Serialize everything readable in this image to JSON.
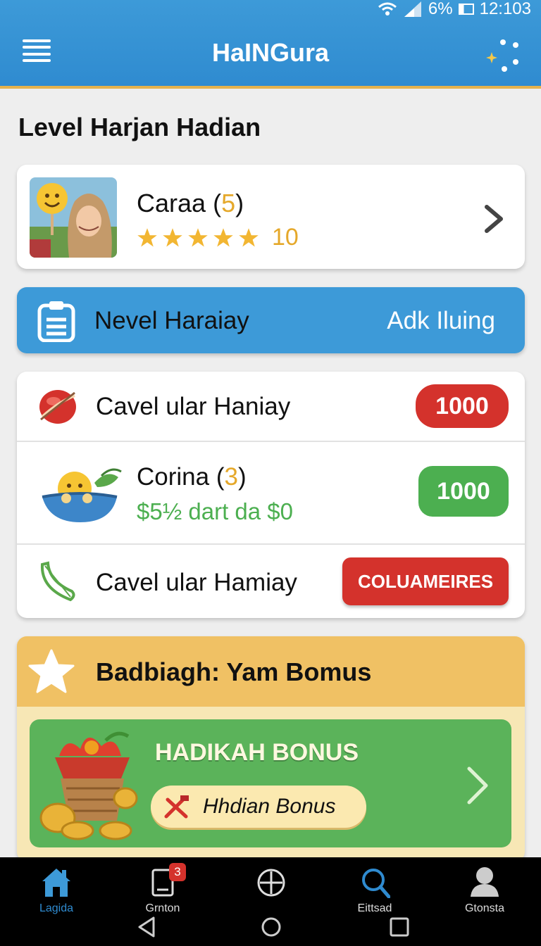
{
  "status_bar": {
    "battery": "6%",
    "time": "12:103"
  },
  "app_bar": {
    "title": "HaINGura"
  },
  "page": {
    "title": "Level Harjan Hadian"
  },
  "profile": {
    "name": "Caraa",
    "count_open": " (",
    "count": "5",
    "count_close": ")",
    "stars": 5,
    "rating": "10"
  },
  "section": {
    "title": "Nevel Haraiay",
    "action": "Adk Iluing"
  },
  "list": {
    "items": [
      {
        "label": "Cavel ular Haniay",
        "value": "1000"
      },
      {
        "label": "Corina",
        "count_open": " (",
        "count": "3",
        "count_close": ")",
        "sub": "$5½ dart da  $0",
        "value": "1000"
      },
      {
        "label": "Cavel ular Hamiay",
        "button": "COLUAMEIRES"
      }
    ]
  },
  "bonus": {
    "title": "Badbiagh:  Yam Bomus",
    "card_title": "HADIKAH BONUS",
    "pill": "Hhdian Bonus"
  },
  "bottom_nav": {
    "items": [
      {
        "label": "Lagida",
        "icon": "home-icon"
      },
      {
        "label": "Grnton",
        "icon": "tablet-icon",
        "badge": "3"
      },
      {
        "label": "",
        "icon": "plus-circle-icon"
      },
      {
        "label": "Eittsad",
        "icon": "search-icon"
      },
      {
        "label": "Gtonsta",
        "icon": "person-icon"
      }
    ]
  },
  "colors": {
    "primary": "#3d9ad8",
    "accent": "#e5a82a",
    "danger": "#d4322c",
    "success": "#4caf50",
    "bonus_header": "#f0c164"
  }
}
